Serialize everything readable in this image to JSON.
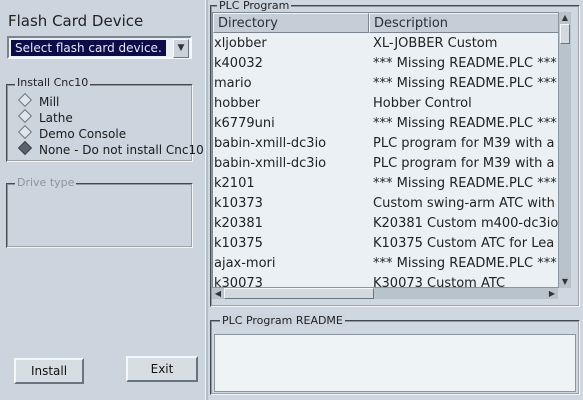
{
  "device": {
    "title": "Flash Card Device",
    "select_value": "Select flash card device.",
    "dropdown_glyph": "▼"
  },
  "install": {
    "legend": "Install Cnc10",
    "options": [
      {
        "label": "Mill",
        "selected": false
      },
      {
        "label": "Lathe",
        "selected": false
      },
      {
        "label": "Demo Console",
        "selected": false
      },
      {
        "label": "None - Do not install Cnc10",
        "selected": true
      }
    ]
  },
  "drive": {
    "legend": "Drive type"
  },
  "buttons": {
    "install_label": "Install",
    "exit_label": "Exit"
  },
  "plc": {
    "legend": "PLC Program",
    "columns": [
      "Directory",
      "Description"
    ],
    "rows": [
      {
        "dir": "xljobber",
        "desc": "XL-JOBBER Custom"
      },
      {
        "dir": "k40032",
        "desc": "*** Missing README.PLC ***"
      },
      {
        "dir": "mario",
        "desc": "*** Missing README.PLC ***"
      },
      {
        "dir": "hobber",
        "desc": "Hobber Control"
      },
      {
        "dir": "k6779uni",
        "desc": "*** Missing README.PLC ***"
      },
      {
        "dir": "babin-xmill-dc3io",
        "desc": "PLC program for M39 with a"
      },
      {
        "dir": "babin-xmill-dc3io",
        "desc": "PLC program for M39 with a"
      },
      {
        "dir": "k2101",
        "desc": "*** Missing README.PLC ***"
      },
      {
        "dir": "k10373",
        "desc": "Custom swing-arm ATC with"
      },
      {
        "dir": "k20381",
        "desc": "K20381 Custom m400-dc3io"
      },
      {
        "dir": "k10375",
        "desc": "K10375 Custom ATC for Lea"
      },
      {
        "dir": "ajax-mori",
        "desc": "*** Missing README.PLC ***"
      },
      {
        "dir": "k30073",
        "desc": "K30073 Custom ATC"
      }
    ]
  },
  "readme": {
    "legend": "PLC Program README"
  },
  "icons": {
    "scroll_up": "▲",
    "scroll_down": "▼",
    "scroll_left": "◀",
    "scroll_right": "▶"
  }
}
